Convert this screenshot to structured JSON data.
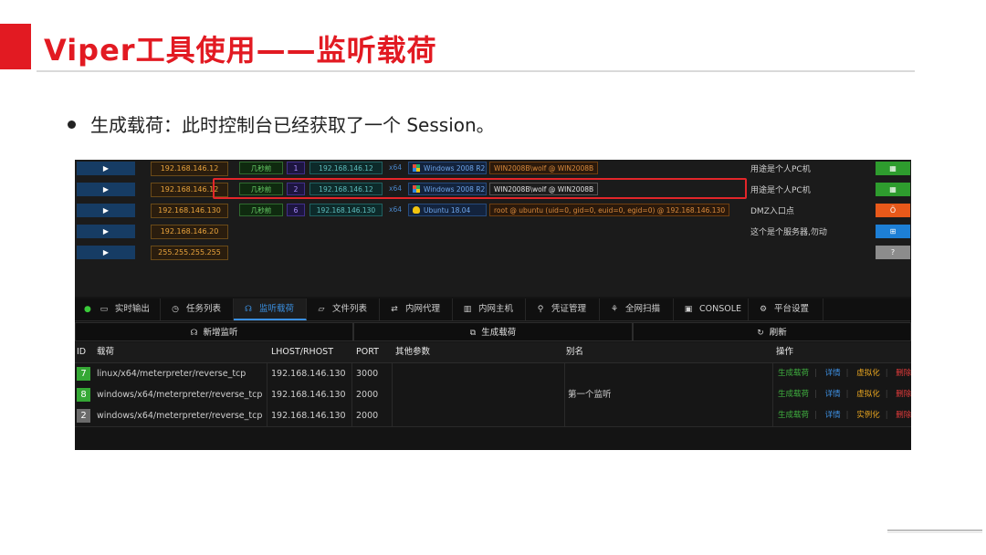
{
  "slide": {
    "title": "Viper工具使用——监听载荷",
    "bullet": "生成载荷：此时控制台已经获取了一个 Session。"
  },
  "colors": {
    "accent_red": "#e21a22",
    "tab_active": "#3a8fe0"
  },
  "hosts": [
    {
      "play": "▶",
      "ip": "192.168.146.12",
      "time": "几秒前",
      "num": "1",
      "session_ip": "192.168.146.12",
      "arch": "x64",
      "os": "Windows 2008 R2",
      "os_icon": "windows-icon",
      "user": "WIN2008B\\wolf @ WIN2008B",
      "remark": "用途是个人PC机",
      "action": "▦",
      "action_color": "green"
    },
    {
      "play": "▶",
      "ip": "192.168.146.12",
      "time": "几秒前",
      "num": "2",
      "session_ip": "192.168.146.12",
      "arch": "x64",
      "os": "Windows 2008 R2",
      "os_icon": "windows-icon",
      "user": "WIN2008B\\wolf @ WIN2008B",
      "remark": "用途是个人PC机",
      "action": "▦",
      "action_color": "green"
    },
    {
      "play": "▶",
      "ip": "192.168.146.130",
      "time": "几秒前",
      "num": "6",
      "session_ip": "192.168.146.130",
      "arch": "x64",
      "os": "Ubuntu 18.04",
      "os_icon": "linux-icon",
      "user": "root @ ubuntu (uid=0, gid=0, euid=0, egid=0) @ 192.168.146.130",
      "remark": "DMZ入口点",
      "action": "Ö",
      "action_color": "orange"
    },
    {
      "play": "▶",
      "ip": "192.168.146.20",
      "remark": "这个是个服务器,勿动",
      "action": "⊞",
      "action_color": "blue"
    },
    {
      "play": "▶",
      "ip": "255.255.255.255",
      "remark": "",
      "action": "?",
      "action_color": "gray"
    }
  ],
  "tabs": [
    {
      "label": "实时输出",
      "icon": "▭"
    },
    {
      "label": "任务列表",
      "icon": "◷"
    },
    {
      "label": "监听载荷",
      "icon": "☊"
    },
    {
      "label": "文件列表",
      "icon": "▱"
    },
    {
      "label": "内网代理",
      "icon": "⇄"
    },
    {
      "label": "内网主机",
      "icon": "▥"
    },
    {
      "label": "凭证管理",
      "icon": "⚲"
    },
    {
      "label": "全网扫描",
      "icon": "⚘"
    },
    {
      "label": "CONSOLE",
      "icon": "▣"
    },
    {
      "label": "平台设置",
      "icon": "⚙"
    }
  ],
  "buttons": {
    "new_listener": "新增监听",
    "new_listener_icon": "☊",
    "gen_payload": "生成载荷",
    "gen_payload_icon": "⧉",
    "refresh": "刷新",
    "refresh_icon": "↻"
  },
  "table": {
    "headers": [
      "ID",
      "载荷",
      "LHOST/RHOST",
      "PORT",
      "其他参数",
      "别名",
      "操作"
    ],
    "rows": [
      {
        "id": "7",
        "payload": "linux/x64/meterpreter/reverse_tcp",
        "host": "192.168.146.130",
        "port": "3000",
        "params": "",
        "alias": "",
        "op_gen": "生成载荷",
        "op_det": "详情",
        "op_mid": "虚拟化",
        "op_del": "删除",
        "active": true
      },
      {
        "id": "8",
        "payload": "windows/x64/meterpreter/reverse_tcp",
        "host": "192.168.146.130",
        "port": "2000",
        "params": "",
        "alias": "第一个监听",
        "op_gen": "生成载荷",
        "op_det": "详情",
        "op_mid": "虚拟化",
        "op_del": "删除",
        "active": true
      },
      {
        "id": "2",
        "payload": "windows/x64/meterpreter/reverse_tcp",
        "host": "192.168.146.130",
        "port": "2000",
        "params": "",
        "alias": "",
        "op_gen": "生成载荷",
        "op_det": "详情",
        "op_mid": "实例化",
        "op_del": "删除",
        "active": false
      }
    ]
  }
}
